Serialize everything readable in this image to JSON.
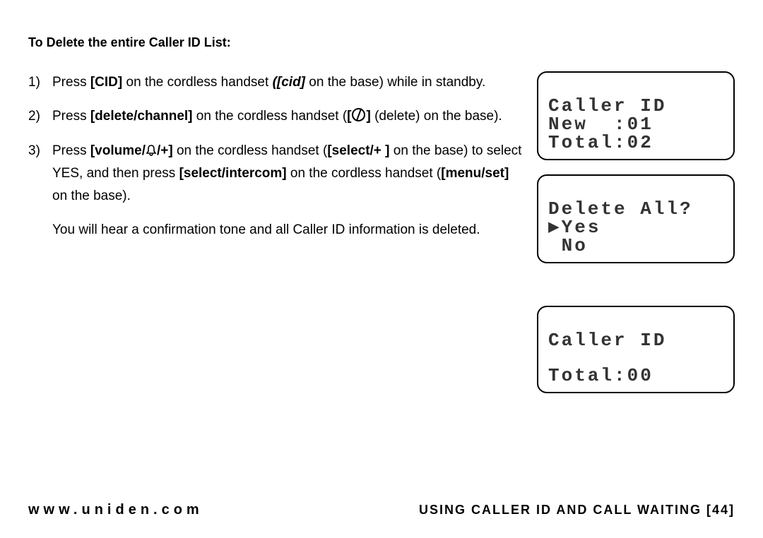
{
  "heading": "To Delete the entire Caller ID List:",
  "steps": {
    "n1": "1)",
    "s1_a": "Press ",
    "s1_b": "[CID]",
    "s1_c": " on the cordless handset ",
    "s1_d": "([cid]",
    "s1_e": " on the base) while in standby.",
    "n2": "2)",
    "s2_a": "Press ",
    "s2_b": "[delete/channel]",
    "s2_c": " on the cordless handset (",
    "s2_d": "[",
    "s2_e": "]",
    "s2_f": " (delete) on the base).",
    "n3": "3)",
    "s3_a": "Press ",
    "s3_b": "[volume/",
    "s3_c": "/+]",
    "s3_d": " on the cordless handset (",
    "s3_e": "[select/+ ]",
    "s3_f": " on the base) to select YES, and then press ",
    "s3_g": "[select/intercom]",
    "s3_h": " on the cordless handset (",
    "s3_i": "[menu/set]",
    "s3_j": " on the base).",
    "after": "You will hear a confirmation tone and all Caller ID information is deleted."
  },
  "screens": {
    "s1_l1": "Caller ID",
    "s1_l2": "New  :01",
    "s1_l3": "Total:02",
    "s2_l1": "Delete All?",
    "s2_l2": "▶Yes",
    "s2_l3": " No",
    "s3_l1": "Caller ID",
    "s3_l2": "Total:00"
  },
  "footer": {
    "left": "www.uniden.com",
    "right": "USING CALLER ID AND CALL WAITING [44]"
  }
}
